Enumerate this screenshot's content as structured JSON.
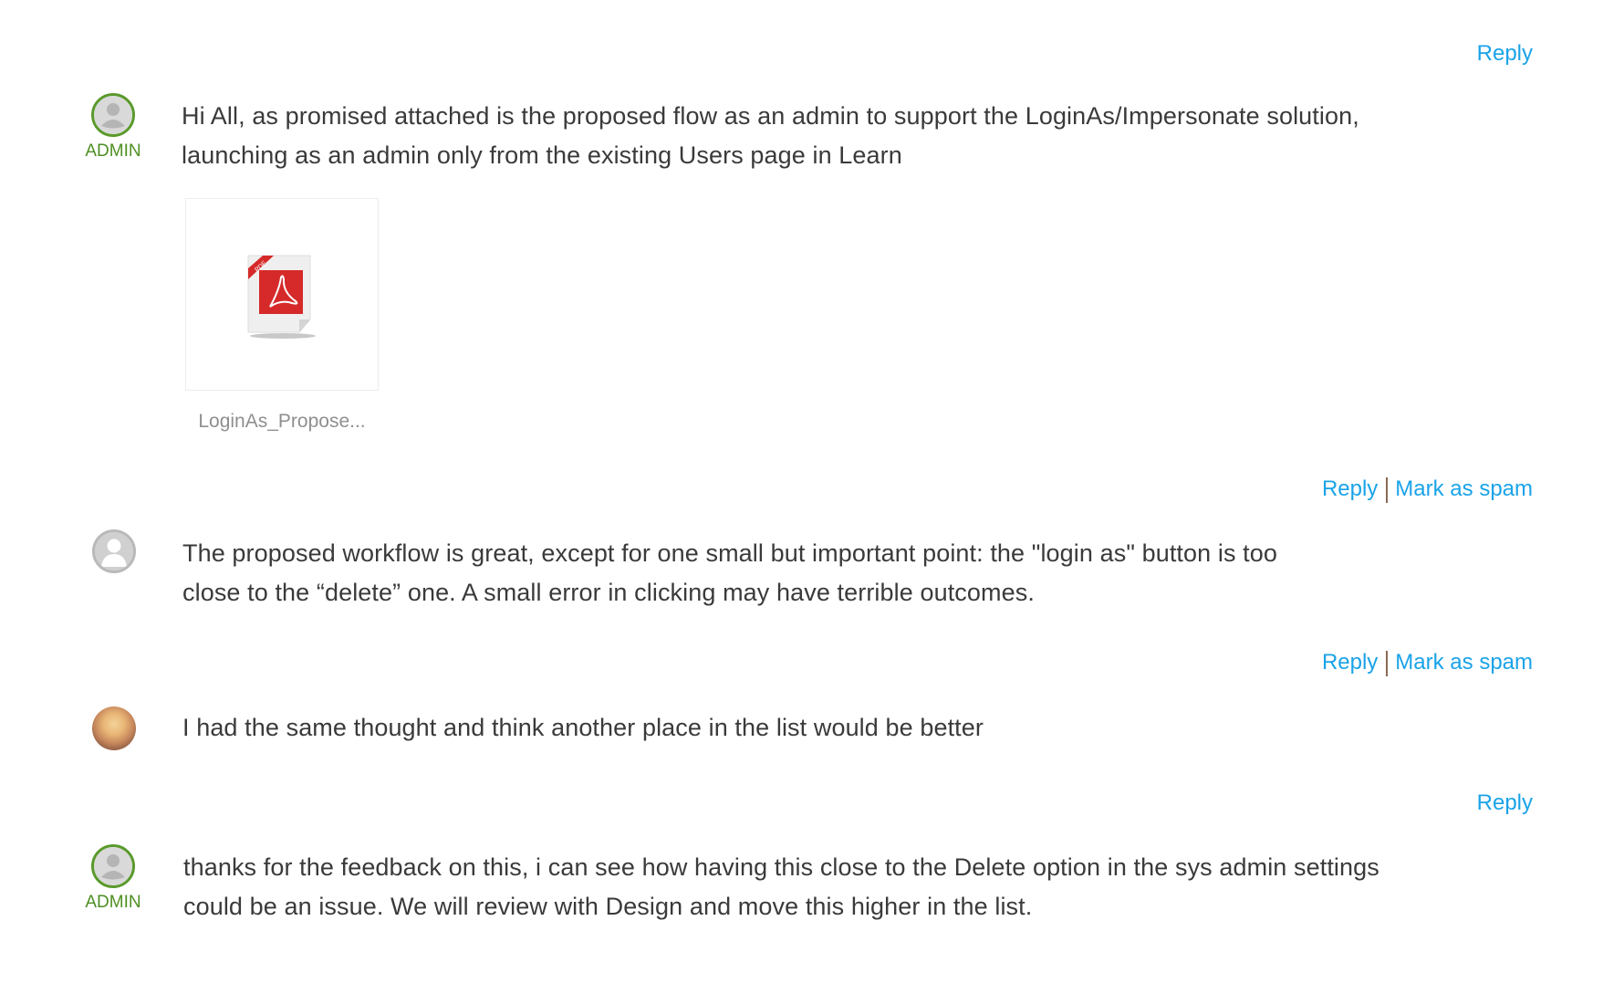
{
  "comments": [
    {
      "role": "ADMIN",
      "avatar": "default-user-icon",
      "text_lines": [
        "Hi All, as promised attached is the proposed flow as an admin to support the LoginAs/Impersonate solution,",
        "launching as an admin only from the existing Users page in Learn"
      ],
      "actions": [
        "Reply"
      ],
      "attachment": {
        "type": "pdf-file-icon",
        "filename": "LoginAs_Propose..."
      }
    },
    {
      "role": "",
      "avatar": "default-user-icon",
      "text_lines": [
        "The proposed workflow is great, except for one small but important point: the \"login as\" button is too",
        "close to the “delete” one. A small error in clicking may have terrible outcomes."
      ],
      "actions": [
        "Reply",
        "Mark as spam"
      ]
    },
    {
      "role": "",
      "avatar": "user-photo",
      "text_lines": [
        "I had the same thought and think another place in the list would be better"
      ],
      "actions": [
        "Reply",
        "Mark as spam"
      ]
    },
    {
      "role": "ADMIN",
      "avatar": "default-user-icon",
      "text_lines": [
        "thanks for the feedback on this, i can see how having this close to the Delete option in the sys admin settings",
        "could be an issue. We will review with Design and move this higher in the list."
      ],
      "actions": [
        "Reply"
      ]
    }
  ],
  "colors": {
    "link": "#1aa3e8",
    "admin": "#5a9a2c",
    "text": "#3a3a3a"
  }
}
